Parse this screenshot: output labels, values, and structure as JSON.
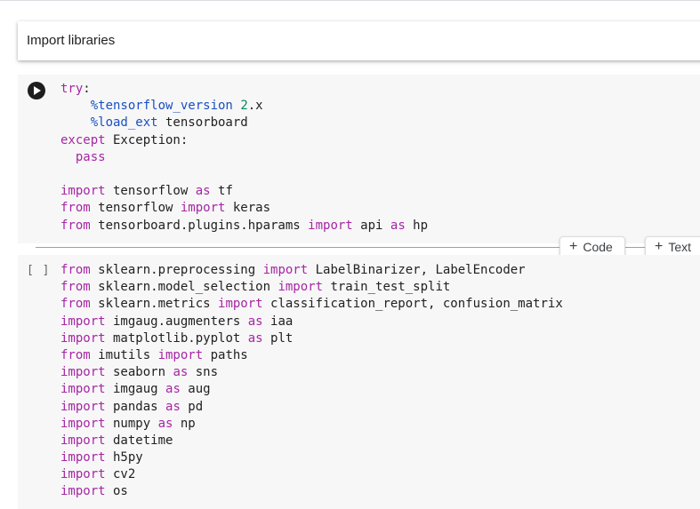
{
  "text_cell": {
    "title": "Import libraries"
  },
  "cell1": {
    "run_icon": "play-icon",
    "lines": [
      [
        {
          "t": "try",
          "c": "kw"
        },
        {
          "t": ":"
        }
      ],
      [
        {
          "t": "    "
        },
        {
          "t": "%tensorflow_version",
          "c": "magic"
        },
        {
          "t": " "
        },
        {
          "t": "2",
          "c": "num"
        },
        {
          "t": ".x"
        }
      ],
      [
        {
          "t": "    "
        },
        {
          "t": "%load_ext",
          "c": "magic"
        },
        {
          "t": " tensorboard"
        }
      ],
      [
        {
          "t": "except",
          "c": "kw"
        },
        {
          "t": " Exception:"
        }
      ],
      [
        {
          "t": "  "
        },
        {
          "t": "pass",
          "c": "kw"
        }
      ],
      [
        {
          "t": ""
        }
      ],
      [
        {
          "t": "import",
          "c": "kw"
        },
        {
          "t": " tensorflow "
        },
        {
          "t": "as",
          "c": "kw"
        },
        {
          "t": " tf"
        }
      ],
      [
        {
          "t": "from",
          "c": "kw"
        },
        {
          "t": " tensorflow "
        },
        {
          "t": "import",
          "c": "kw"
        },
        {
          "t": " keras"
        }
      ],
      [
        {
          "t": "from",
          "c": "kw"
        },
        {
          "t": " tensorboard.plugins.hparams "
        },
        {
          "t": "import",
          "c": "kw"
        },
        {
          "t": " api "
        },
        {
          "t": "as",
          "c": "kw"
        },
        {
          "t": " hp"
        }
      ]
    ]
  },
  "toolbar": {
    "add_code_label": "Code",
    "add_text_label": "Text",
    "plus_icon": "+"
  },
  "cell2": {
    "exec_indicator": "[ ]",
    "lines": [
      [
        {
          "t": "from",
          "c": "kw"
        },
        {
          "t": " sklearn.preprocessing "
        },
        {
          "t": "import",
          "c": "kw"
        },
        {
          "t": " LabelBinarizer, LabelEncoder"
        }
      ],
      [
        {
          "t": "from",
          "c": "kw"
        },
        {
          "t": " sklearn.model_selection "
        },
        {
          "t": "import",
          "c": "kw"
        },
        {
          "t": " train_test_split"
        }
      ],
      [
        {
          "t": "from",
          "c": "kw"
        },
        {
          "t": " sklearn.metrics "
        },
        {
          "t": "import",
          "c": "kw"
        },
        {
          "t": " classification_report, confusion_matrix"
        }
      ],
      [
        {
          "t": "import",
          "c": "kw"
        },
        {
          "t": " imgaug.augmenters "
        },
        {
          "t": "as",
          "c": "kw"
        },
        {
          "t": " iaa"
        }
      ],
      [
        {
          "t": "import",
          "c": "kw"
        },
        {
          "t": " matplotlib.pyplot "
        },
        {
          "t": "as",
          "c": "kw"
        },
        {
          "t": " plt"
        }
      ],
      [
        {
          "t": "from",
          "c": "kw"
        },
        {
          "t": " imutils "
        },
        {
          "t": "import",
          "c": "kw"
        },
        {
          "t": " paths"
        }
      ],
      [
        {
          "t": "import",
          "c": "kw"
        },
        {
          "t": " seaborn "
        },
        {
          "t": "as",
          "c": "kw"
        },
        {
          "t": " sns"
        }
      ],
      [
        {
          "t": "import",
          "c": "kw"
        },
        {
          "t": " imgaug "
        },
        {
          "t": "as",
          "c": "kw"
        },
        {
          "t": " aug"
        }
      ],
      [
        {
          "t": "import",
          "c": "kw"
        },
        {
          "t": " pandas "
        },
        {
          "t": "as",
          "c": "kw"
        },
        {
          "t": " pd"
        }
      ],
      [
        {
          "t": "import",
          "c": "kw"
        },
        {
          "t": " numpy "
        },
        {
          "t": "as",
          "c": "kw"
        },
        {
          "t": " np"
        }
      ],
      [
        {
          "t": "import",
          "c": "kw"
        },
        {
          "t": " datetime"
        }
      ],
      [
        {
          "t": "import",
          "c": "kw"
        },
        {
          "t": " h5py"
        }
      ],
      [
        {
          "t": "import",
          "c": "kw"
        },
        {
          "t": " cv2"
        }
      ],
      [
        {
          "t": "import",
          "c": "kw"
        },
        {
          "t": " os"
        }
      ]
    ]
  }
}
